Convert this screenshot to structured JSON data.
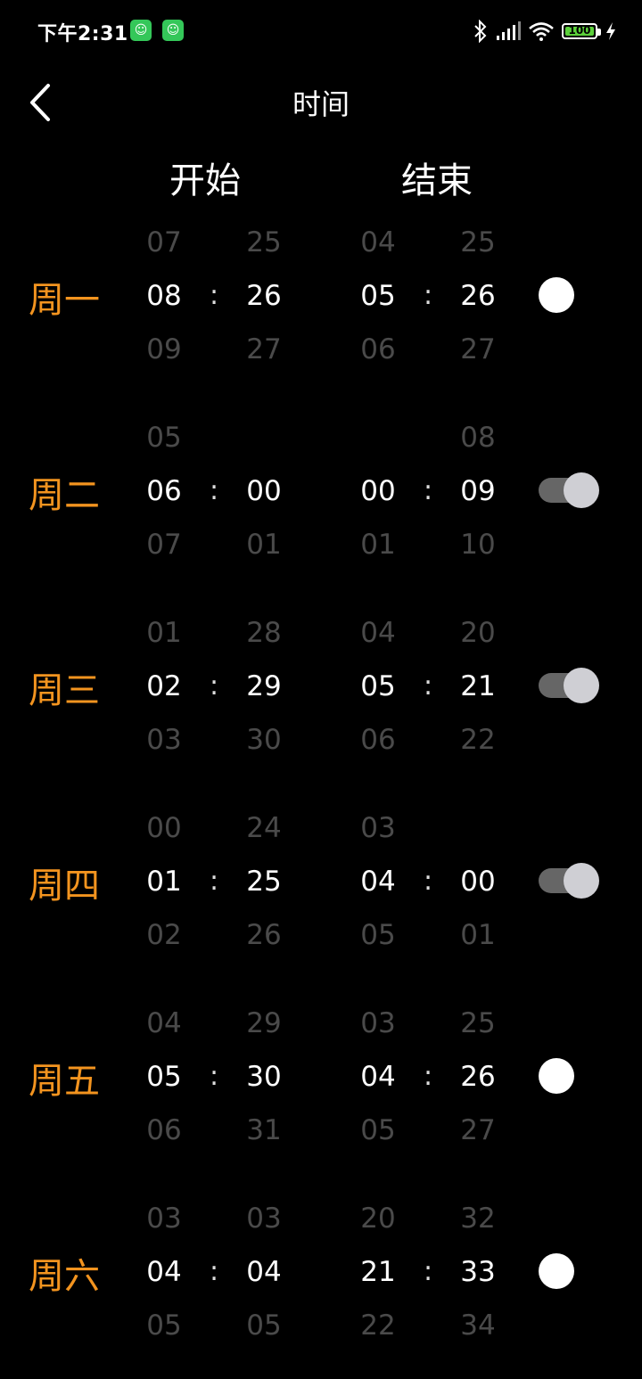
{
  "status_bar": {
    "time": "下午2:31",
    "battery": "100"
  },
  "header": {
    "title": "时间"
  },
  "columns": {
    "start": "开始",
    "end": "结束"
  },
  "separator": ":",
  "days": [
    {
      "label": "周一",
      "start_hour": [
        "07",
        "08",
        "09"
      ],
      "start_min": [
        "25",
        "26",
        "27"
      ],
      "end_hour": [
        "04",
        "05",
        "06"
      ],
      "end_min": [
        "25",
        "26",
        "27"
      ],
      "enabled": false
    },
    {
      "label": "周二",
      "start_hour": [
        "05",
        "06",
        "07"
      ],
      "start_min": [
        "",
        "00",
        "01"
      ],
      "end_hour": [
        "",
        "00",
        "01"
      ],
      "end_min": [
        "08",
        "09",
        "10"
      ],
      "enabled": true
    },
    {
      "label": "周三",
      "start_hour": [
        "01",
        "02",
        "03"
      ],
      "start_min": [
        "28",
        "29",
        "30"
      ],
      "end_hour": [
        "04",
        "05",
        "06"
      ],
      "end_min": [
        "20",
        "21",
        "22"
      ],
      "enabled": true
    },
    {
      "label": "周四",
      "start_hour": [
        "00",
        "01",
        "02"
      ],
      "start_min": [
        "24",
        "25",
        "26"
      ],
      "end_hour": [
        "03",
        "04",
        "05"
      ],
      "end_min": [
        "",
        "00",
        "01"
      ],
      "enabled": true
    },
    {
      "label": "周五",
      "start_hour": [
        "04",
        "05",
        "06"
      ],
      "start_min": [
        "29",
        "30",
        "31"
      ],
      "end_hour": [
        "03",
        "04",
        "05"
      ],
      "end_min": [
        "25",
        "26",
        "27"
      ],
      "enabled": false
    },
    {
      "label": "周六",
      "start_hour": [
        "03",
        "04",
        "05"
      ],
      "start_min": [
        "03",
        "04",
        "05"
      ],
      "end_hour": [
        "20",
        "21",
        "22"
      ],
      "end_min": [
        "32",
        "33",
        "34"
      ],
      "enabled": false
    }
  ]
}
